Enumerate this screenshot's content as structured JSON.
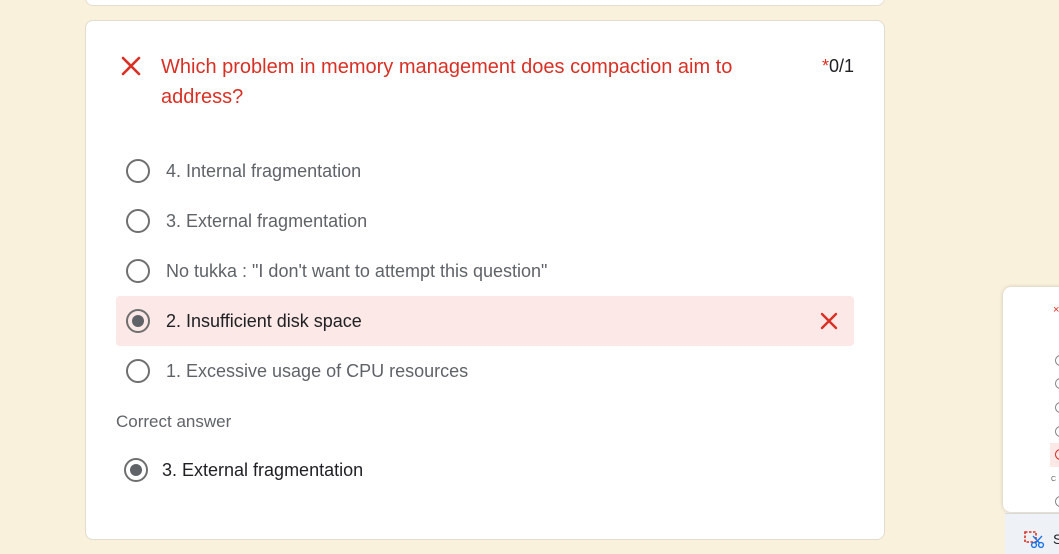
{
  "question": {
    "text": "Which problem in memory management does compaction aim to address?",
    "status_icon": "x-icon",
    "score_asterisk": "*",
    "score": "0/1"
  },
  "options": [
    {
      "label": "4. Internal fragmentation",
      "selected": false,
      "wrong": false
    },
    {
      "label": "3. External fragmentation",
      "selected": false,
      "wrong": false
    },
    {
      "label": "No tukka : \"I don't want to attempt this question\"",
      "selected": false,
      "wrong": false
    },
    {
      "label": "2. Insufficient disk space",
      "selected": true,
      "wrong": true
    },
    {
      "label": "1. Excessive usage of CPU resources",
      "selected": false,
      "wrong": false
    }
  ],
  "correct_answer": {
    "title": "Correct answer",
    "label": "3. External fragmentation"
  },
  "side_window": {
    "close_glyph": "×",
    "partial_text": "C"
  },
  "taskbar": {
    "partial_label": "S",
    "icon": "snipping-tool-icon"
  },
  "colors": {
    "error": "#d93025",
    "wrong_bg": "#fce8e6",
    "page_bg": "#f9f1dc"
  }
}
